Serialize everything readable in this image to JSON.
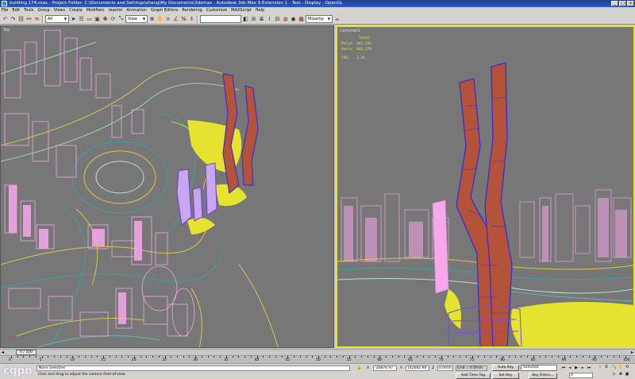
{
  "window": {
    "title": "building 174.max     - Project Folder: C:\\Documents and Settings\\zhang\\My Documents\\3dsmax     - Autodesk 3ds Max 9 Extension 1 - Test     - Display : OpenGL",
    "buttons": [
      "_",
      "□",
      "x"
    ]
  },
  "menu": [
    "File",
    "Edit",
    "Tools",
    "Group",
    "Views",
    "Create",
    "Modifiers",
    "reactor",
    "Animation",
    "Graph Editors",
    "Rendering",
    "Customize",
    "MAXScript",
    "Help"
  ],
  "toolbar": {
    "selection_filter": "All",
    "reference_coord": "View",
    "named_selection": "Mixamp"
  },
  "viewports": {
    "left": {
      "label": "Top"
    },
    "right": {
      "label": "Camera01",
      "stats": {
        "header": "Total",
        "polys_label": "Polys:",
        "polys": "941,156",
        "verts_label": "Verts:",
        "verts": "482,179",
        "fps_label": "FPS:",
        "fps": "3.26"
      }
    }
  },
  "timeline": {
    "frame_display": "0 / 100",
    "ticks": [
      0,
      5,
      10,
      15,
      20,
      25,
      30,
      35,
      40,
      45,
      50,
      55,
      60,
      65,
      70,
      75,
      80,
      85,
      90,
      95,
      100
    ]
  },
  "status": {
    "selection": "None Selected",
    "prompt": "Click and drag to adjust the camera field-of-view",
    "x_label": "X",
    "x_value": "-26876.97",
    "y_label": "Y",
    "y_value": "142682.96",
    "z_label": "Z",
    "z_value": "0.0mm",
    "grid": "Grid = 0.0mm",
    "auto_key": "Auto Key",
    "set_key": "Set Key",
    "key_filters": "Key Filters...",
    "key_mode": "Selected",
    "add_time_tag": "Add Time Tag",
    "current_frame": "0",
    "logo": "cgpn"
  }
}
